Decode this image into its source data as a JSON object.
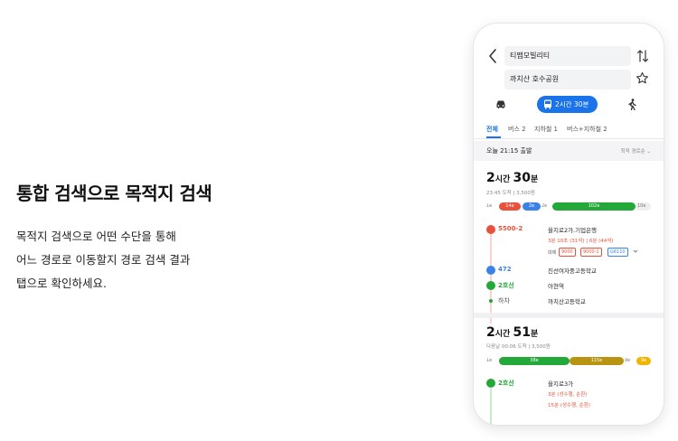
{
  "intro": {
    "title": "통합 검색으로 목적지 검색",
    "lines": [
      "목적지 검색으로 어떤 수단을 통해",
      "어느 경로로 이동할지 경로 검색 결과",
      "탭으로 확인하세요."
    ]
  },
  "search": {
    "from": "티맵모빌리티",
    "to": "까치산 호수공원"
  },
  "modes": {
    "transit_label": "2시간 30분"
  },
  "tabs": [
    "전체",
    "버스 2",
    "지하철 1",
    "버스+지하철 2"
  ],
  "depart": {
    "text": "오늘 21:15 출발",
    "sort": "최적 경로순"
  },
  "routes": [
    {
      "hours": "2",
      "hours_unit": "시간",
      "mins": "30",
      "mins_unit": "분",
      "arrive": "23:45 도착  |  3,500원",
      "segments": [
        {
          "label": "1e",
          "color": "#ffffff",
          "type": "walk",
          "icon": "walk-icon"
        },
        {
          "label": "14e",
          "color": "#e8523c",
          "type": "bus",
          "icon": "bus-icon"
        },
        {
          "label": "2e",
          "color": "#3b82e6",
          "type": "bus",
          "icon": "bus-icon"
        },
        {
          "label": "2e",
          "color": "#ffffff",
          "type": "walk",
          "icon": "walk-icon"
        },
        {
          "label": "102e",
          "color": "#25a83a",
          "type": "subway",
          "icon": "subway-icon"
        },
        {
          "label": "10e",
          "color": "#eeeeee",
          "type": "walk",
          "icon": "walk-icon"
        }
      ],
      "legs": [
        {
          "line": "5500-2",
          "color": "#e8523c",
          "stop": "을지로2가.기업은행",
          "detail": "3분 10초 (31석)  |  6분 (44석)",
          "alt_label": "대체",
          "alts": [
            "9000",
            "9000-1",
            "G6110"
          ],
          "alt_colors": [
            "#e8523c",
            "#e8523c",
            "#3b82e6"
          ]
        },
        {
          "line": "472",
          "color": "#3b82e6",
          "stop": "진선여자중고등학교"
        },
        {
          "line": "2호선",
          "color": "#25a83a",
          "stop": "아현역"
        },
        {
          "line": "하차",
          "color": "#25a83a",
          "stop": "까치산고등학교"
        }
      ]
    },
    {
      "hours": "2",
      "hours_unit": "시간",
      "mins": "51",
      "mins_unit": "분",
      "arrive": "다음날 00:06 도착  |  3,500원",
      "segments": [
        {
          "label": "1e",
          "color": "#ffffff",
          "type": "walk",
          "icon": "walk-icon"
        },
        {
          "label": "38e",
          "color": "#25a83a",
          "type": "subway",
          "icon": "subway-icon"
        },
        {
          "label": "115e",
          "color": "#b89412",
          "type": "subway",
          "icon": "subway-icon"
        },
        {
          "label": "8e",
          "color": "#ffffff",
          "type": "walk",
          "icon": "walk-icon"
        },
        {
          "label": "9e",
          "color": "#f0b400",
          "type": "subway",
          "icon": "subway-icon"
        }
      ],
      "legs": [
        {
          "line": "2호선",
          "color": "#25a83a",
          "stop": "을지로3가",
          "detail": "3분 (성수행, 순환)",
          "detail2": "15분 (성수행, 순환)"
        }
      ]
    }
  ],
  "colors": {
    "accent": "#1a73e8"
  }
}
